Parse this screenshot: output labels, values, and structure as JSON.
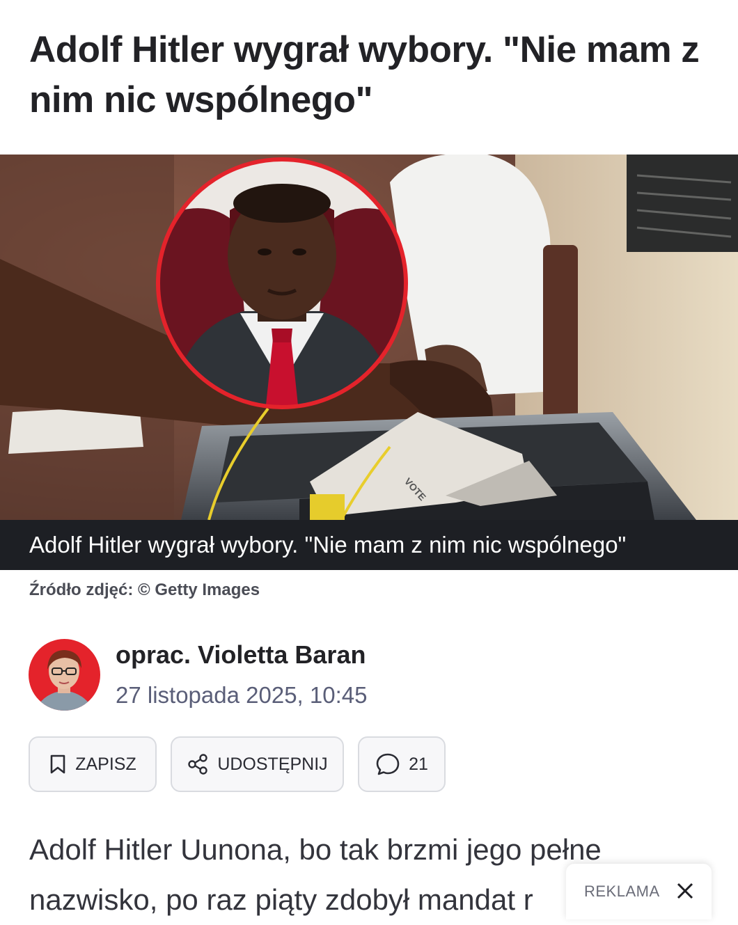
{
  "article": {
    "title": "Adolf Hitler wygrał wybory. \"Nie mam z nim nic wspólnego\"",
    "image_caption": "Adolf Hitler wygrał wybory. \"Nie mam z nim nic wspólnego\"",
    "image_ballot_text": "VOTE",
    "image_source": "Źródło zdjęć: © Getty Images",
    "author": "oprac. Violetta Baran",
    "date": "27 listopada 2025, 10:45",
    "body": "Adolf Hitler Uunona, bo tak brzmi jego pełne nazwisko, po raz piąty zdobył mandat r"
  },
  "actions": {
    "save_label": "ZAPISZ",
    "share_label": "UDOSTĘPNIJ",
    "comments_count": "21"
  },
  "ad": {
    "label": "REKLAMA"
  },
  "icons": {
    "save": "bookmark-icon",
    "share": "share-icon",
    "comments": "comment-bubble-icon",
    "close": "close-icon"
  },
  "colors": {
    "accent_red": "#e4232b",
    "caption_bg": "#1d1f24",
    "date_text": "#5a5e78"
  }
}
